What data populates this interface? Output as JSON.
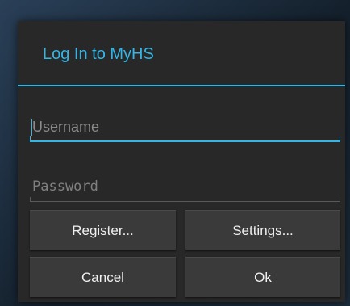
{
  "dialog": {
    "title": "Log In to MyHS",
    "accent_color": "#33b5e5"
  },
  "form": {
    "username": {
      "value": "",
      "placeholder": "Username",
      "focused": true
    },
    "password": {
      "value": "",
      "placeholder": "Password"
    }
  },
  "buttons": {
    "register_label": "Register...",
    "settings_label": "Settings...",
    "cancel_label": "Cancel",
    "ok_label": "Ok"
  }
}
